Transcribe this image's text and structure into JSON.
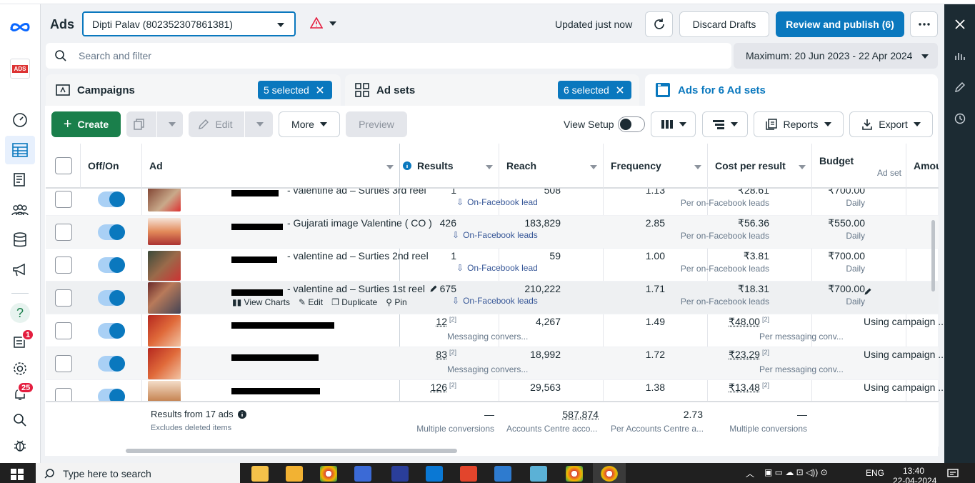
{
  "header": {
    "app_title": "Ads",
    "account": "Dipti Palav (802352307861381)",
    "status": "Updated just now",
    "discard_label": "Discard Drafts",
    "publish_label": "Review and publish (6)"
  },
  "search": {
    "placeholder": "Search and filter",
    "date_range": "Maximum: 20 Jun 2023 - 22 Apr 2024"
  },
  "tabs": {
    "campaigns": {
      "label": "Campaigns",
      "selected": "5 selected"
    },
    "adsets": {
      "label": "Ad sets",
      "selected": "6 selected"
    },
    "ads": {
      "label": "Ads for 6 Ad sets"
    }
  },
  "toolbar": {
    "create": "Create",
    "edit": "Edit",
    "more": "More",
    "preview": "Preview",
    "view_setup": "View Setup",
    "reports": "Reports",
    "export": "Export"
  },
  "columns": {
    "offon": "Off/On",
    "ad": "Ad",
    "results": "Results",
    "reach": "Reach",
    "frequency": "Frequency",
    "cost": "Cost per result",
    "budget": "Budget",
    "budget_sub": "Ad set",
    "amount": "Amou"
  },
  "rows": [
    {
      "name": "- valentine ad – Surties 3rd reel",
      "results": "1",
      "result_type": "On-Facebook lead",
      "reach": "508",
      "freq": "1.13",
      "cost": "₹28.61",
      "cost_sub": "Per on-Facebook leads",
      "budget": "₹700.00",
      "budget_sub": "Daily"
    },
    {
      "name": "- Gujarati image Valentine ( CO )",
      "results": "426",
      "result_type": "On-Facebook leads",
      "reach": "183,829",
      "freq": "2.85",
      "cost": "₹56.36",
      "cost_sub": "Per on-Facebook leads",
      "budget": "₹550.00",
      "budget_sub": "Daily"
    },
    {
      "name": "- valentine ad – Surties 2nd reel",
      "results": "1",
      "result_type": "On-Facebook lead",
      "reach": "59",
      "freq": "1.00",
      "cost": "₹3.81",
      "cost_sub": "Per on-Facebook leads",
      "budget": "₹700.00",
      "budget_sub": "Daily"
    },
    {
      "name": "- valentine ad – Surties 1st reel",
      "results": "675",
      "result_type": "On-Facebook leads",
      "reach": "210,222",
      "freq": "1.71",
      "cost": "₹18.31",
      "cost_sub": "Per on-Facebook leads",
      "budget": "₹700.00",
      "budget_sub": "Daily",
      "actions": {
        "charts": "View Charts",
        "edit": "Edit",
        "duplicate": "Duplicate",
        "pin": "Pin"
      }
    },
    {
      "name": "",
      "results": "12",
      "result_sup": "[2]",
      "result_type": "Messaging convers...",
      "reach": "4,267",
      "freq": "1.49",
      "cost": "₹48.00",
      "cost_sup": "[2]",
      "cost_sub": "Per messaging conv...",
      "budget": "Using campaign ..."
    },
    {
      "name": "",
      "results": "83",
      "result_sup": "[2]",
      "result_type": "Messaging convers...",
      "reach": "18,992",
      "freq": "1.72",
      "cost": "₹23.29",
      "cost_sup": "[2]",
      "cost_sub": "Per messaging conv...",
      "budget": "Using campaign ..."
    },
    {
      "name": "",
      "results": "126",
      "result_sup": "[2]",
      "result_type": "",
      "reach": "29,563",
      "freq": "1.38",
      "cost": "₹13.48",
      "cost_sup": "[2]",
      "cost_sub": "",
      "budget": "Using campaign ..."
    }
  ],
  "footer": {
    "label": "Results from 17 ads",
    "sub": "Excludes deleted items",
    "results": "—",
    "results_sub": "Multiple conversions",
    "reach": "587,874",
    "reach_sub": "Accounts Centre acco...",
    "freq": "2.73",
    "freq_sub": "Per Accounts Centre a...",
    "cost": "—",
    "cost_sub": "Multiple conversions"
  },
  "leftnav": {
    "thumb_text": "ADS",
    "help_label": "?",
    "badge_notif": "1",
    "badge_alerts": "25"
  },
  "taskbar": {
    "search_placeholder": "Type here to search",
    "lang": "ENG",
    "time": "13:40",
    "date": "22-04-2024"
  },
  "colors": {
    "blue": "#0a78be",
    "green": "#1a7f4b",
    "link": "#385898"
  }
}
